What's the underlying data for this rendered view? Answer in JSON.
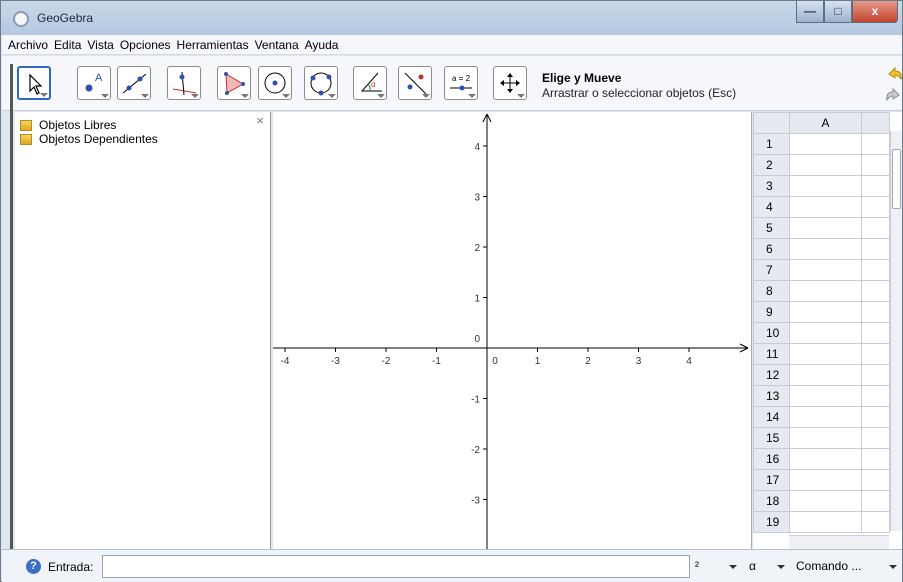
{
  "window": {
    "title": "GeoGebra",
    "buttons": {
      "minimize": "—",
      "maximize": "□",
      "close": "x"
    }
  },
  "menu": [
    "Archivo",
    "Edita",
    "Vista",
    "Opciones",
    "Herramientas",
    "Ventana",
    "Ayuda"
  ],
  "toolbar": {
    "tools": [
      {
        "icon": "move-arrow-icon",
        "selected": true
      },
      {
        "icon": "point-icon",
        "label": "A"
      },
      {
        "icon": "line-icon"
      },
      {
        "icon": "perpendicular-line-icon"
      },
      {
        "icon": "polygon-icon"
      },
      {
        "icon": "circle-center-point-icon"
      },
      {
        "icon": "circle-three-points-icon"
      },
      {
        "icon": "angle-icon",
        "label": "α"
      },
      {
        "icon": "reflect-icon"
      },
      {
        "icon": "slider-icon",
        "label": "a = 2"
      },
      {
        "icon": "move-graphics-view-icon"
      }
    ],
    "tool_name": "Elige y Mueve",
    "tool_description": "Arrastrar o seleccionar objetos (Esc)"
  },
  "algebra": {
    "folders": [
      "Objetos Libres",
      "Objetos Dependientes"
    ],
    "close_symbol": "×"
  },
  "graphics": {
    "x_ticks": [
      "-4",
      "-3",
      "-2",
      "-1",
      "0",
      "1",
      "2",
      "3",
      "4"
    ],
    "y_ticks": [
      "4",
      "3",
      "2",
      "1",
      "0",
      "-1",
      "-2",
      "-3"
    ],
    "axes_color": "#000000"
  },
  "spreadsheet": {
    "columns": [
      "A"
    ],
    "rows": [
      "1",
      "2",
      "3",
      "4",
      "5",
      "6",
      "7",
      "8",
      "9",
      "10",
      "11",
      "12",
      "13",
      "14",
      "15",
      "16",
      "17",
      "18",
      "19"
    ]
  },
  "inputbar": {
    "help_symbol": "?",
    "label": "Entrada:",
    "value": "",
    "superscript_drop": "²",
    "greek_drop": "α",
    "command_drop": "Comando ..."
  },
  "colors": {
    "selected_tool_border": "#3068c8",
    "window_frame": "#b4c8e0"
  }
}
